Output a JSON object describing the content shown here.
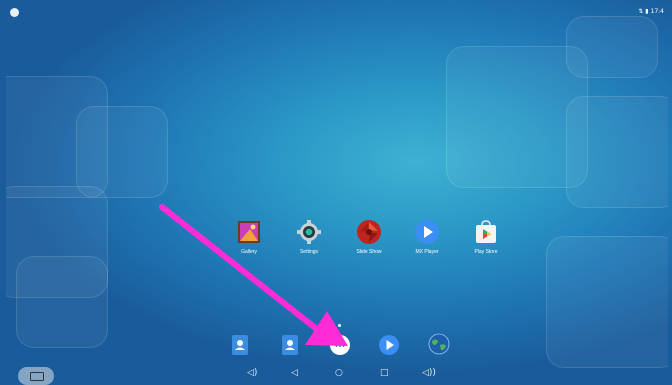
{
  "status_bar": {
    "left_icon": "circle-icon",
    "right_text": "⇅ ▮ 17:4"
  },
  "apps": [
    {
      "name": "gallery",
      "label": "Gallery",
      "icon": "gallery-icon"
    },
    {
      "name": "settings",
      "label": "Settings",
      "icon": "gear-icon"
    },
    {
      "name": "slide-show",
      "label": "Slide Show",
      "icon": "slideshow-icon"
    },
    {
      "name": "mx-player",
      "label": "MX Player",
      "icon": "play-icon"
    },
    {
      "name": "play-store",
      "label": "Play Store",
      "icon": "play-store-icon"
    }
  ],
  "dock": [
    {
      "name": "contacts",
      "icon": "contacts-icon"
    },
    {
      "name": "contacts-alt",
      "icon": "contacts-icon"
    },
    {
      "name": "app-drawer",
      "icon": "app-drawer-icon"
    },
    {
      "name": "media-player",
      "icon": "play-icon"
    },
    {
      "name": "browser",
      "icon": "globe-icon"
    }
  ],
  "nav_bar": [
    {
      "name": "volume-down",
      "icon": "volume-down-icon",
      "glyph": "◁)"
    },
    {
      "name": "back",
      "icon": "back-icon",
      "glyph": "◁"
    },
    {
      "name": "home",
      "icon": "home-icon",
      "glyph": "○"
    },
    {
      "name": "recents",
      "icon": "recents-icon",
      "glyph": "□"
    },
    {
      "name": "volume-up",
      "icon": "volume-up-icon",
      "glyph": "◁))"
    }
  ],
  "colors": {
    "accent": "#ff2bd6",
    "wallpaper": "#2a97c6"
  }
}
